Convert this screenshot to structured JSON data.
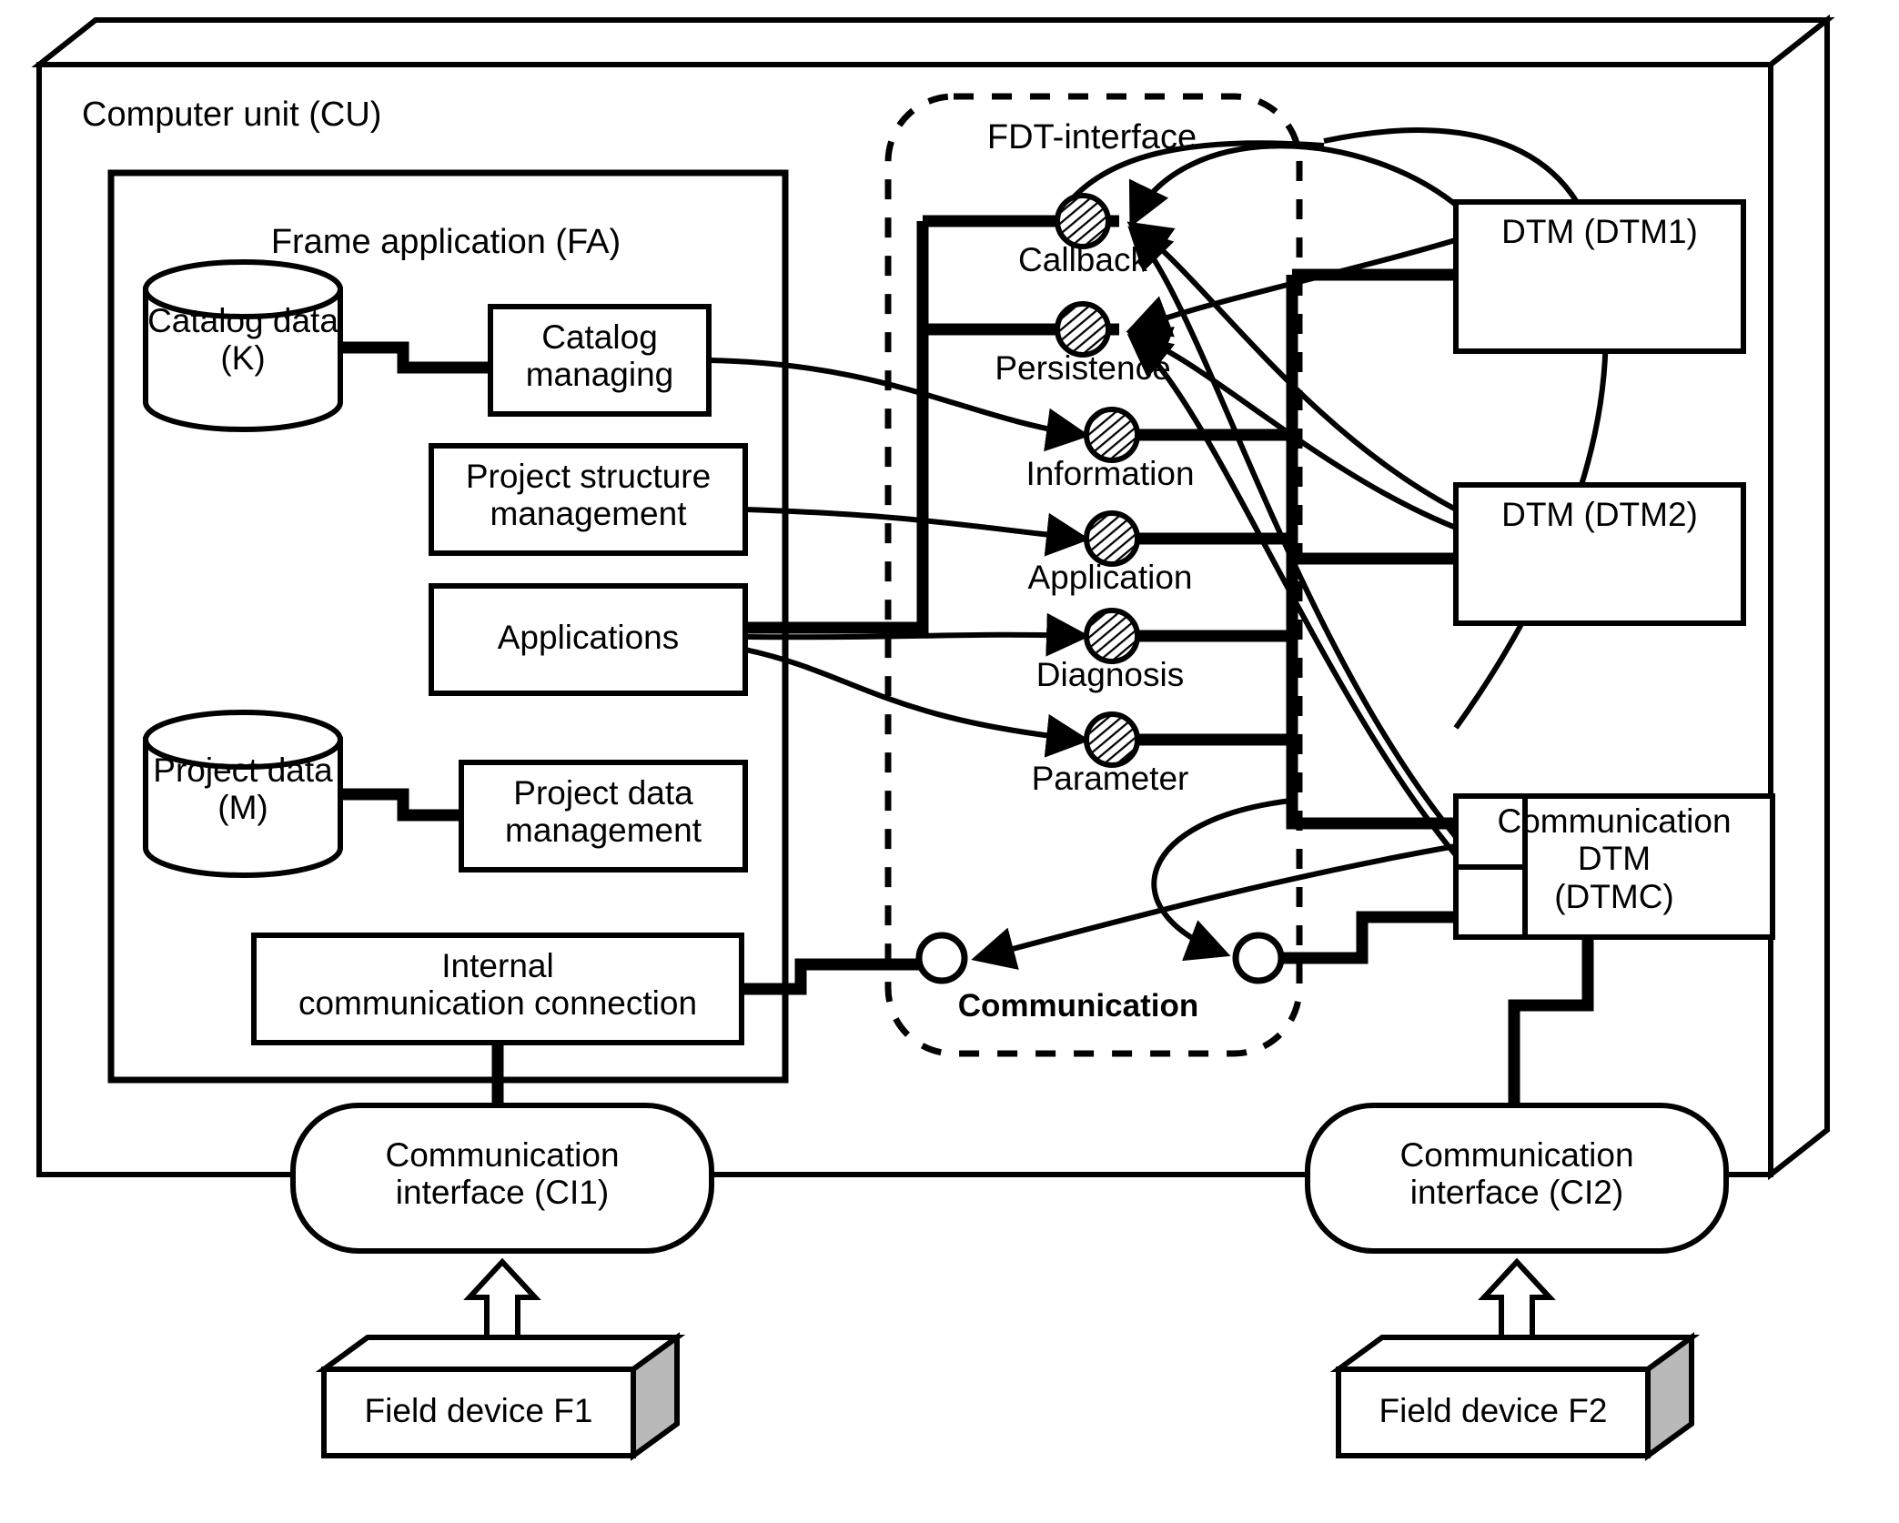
{
  "diagram": {
    "title": "FDT frame application architecture",
    "outer_container_label": "Computer unit (CU)",
    "frame_application_label": "Frame application (FA)",
    "fdt_interface_label": "FDT-interface"
  },
  "frame_application": {
    "stores": [
      {
        "name": "catalog-data-store",
        "label": "Catalog data\n(K)"
      },
      {
        "name": "project-data-store",
        "label": "Project data\n(M)"
      }
    ],
    "boxes": [
      {
        "name": "catalog-managing-box",
        "label": "Catalog\nmanaging"
      },
      {
        "name": "project-structure-management-box",
        "label": "Project structure\nmanagement"
      },
      {
        "name": "applications-box",
        "label": "Applications"
      },
      {
        "name": "project-data-management-box",
        "label": "Project data\nmanagement"
      },
      {
        "name": "internal-communication-connection-box",
        "label": "Internal\ncommunication connection"
      }
    ]
  },
  "fdt_interfaces": [
    {
      "name": "callback-interface",
      "label": "Callback",
      "marker": "hatched-circle",
      "direction": "in"
    },
    {
      "name": "persistence-interface",
      "label": "Persistence",
      "marker": "hatched-circle",
      "direction": "in"
    },
    {
      "name": "information-interface",
      "label": "Information",
      "marker": "hatched-circle",
      "direction": "out"
    },
    {
      "name": "application-interface",
      "label": "Application",
      "marker": "hatched-circle",
      "direction": "out"
    },
    {
      "name": "diagnosis-interface",
      "label": "Diagnosis",
      "marker": "hatched-circle",
      "direction": "out"
    },
    {
      "name": "parameter-interface",
      "label": "Parameter",
      "marker": "hatched-circle",
      "direction": "out"
    },
    {
      "name": "communication-interface-node",
      "label": "Communication",
      "marker": "open-circle",
      "direction": "both"
    }
  ],
  "dtms": [
    {
      "name": "dtm1-box",
      "label": "DTM (DTM1)"
    },
    {
      "name": "dtm2-box",
      "label": "DTM (DTM2)"
    },
    {
      "name": "dtmc-box",
      "label": "Communication\nDTM\n(DTMC)"
    }
  ],
  "communication_interfaces": [
    {
      "name": "communication-interface-ci1",
      "label": "Communication\ninterface (CI1)"
    },
    {
      "name": "communication-interface-ci2",
      "label": "Communication\ninterface (CI2)"
    }
  ],
  "field_devices": [
    {
      "name": "field-device-f1",
      "label": "Field device F1"
    },
    {
      "name": "field-device-f2",
      "label": "Field device F2"
    }
  ],
  "colors": {
    "stroke": "#000000",
    "fill": "#ffffff",
    "shade": "#b9b9b9"
  }
}
